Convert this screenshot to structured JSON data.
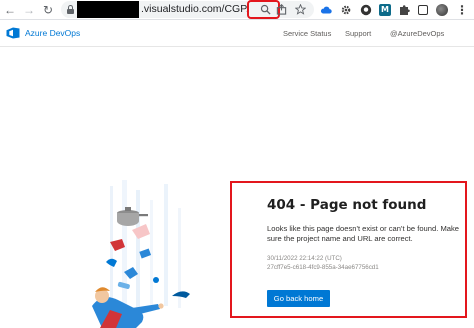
{
  "browser": {
    "back_icon": "←",
    "forward_icon": "→",
    "reload_icon": "↻",
    "url_visible": ".visualstudio.com/CGP.",
    "address_icons": {
      "search": "search-icon",
      "share": "share-icon",
      "bookmark": "star-icon"
    },
    "extensions": [
      "cloud-icon",
      "gear-icon",
      "github-icon",
      "m-extension-icon",
      "puzzle-icon",
      "sidepanel-icon",
      "avatar",
      "menu-dots-icon"
    ],
    "extension_m_label": "M",
    "menu_label": "⋮",
    "accent_color": "#1a73e8"
  },
  "header": {
    "brand": "Azure DevOps",
    "links": {
      "service_status": "Service Status",
      "support": "Support",
      "twitter": "@AzureDevOps"
    },
    "brand_color": "#0078d4"
  },
  "error": {
    "title": "404 - Page not found",
    "description": "Looks like this page doesn't exist or can't be found. Make sure the project name and URL are correct.",
    "timestamp": "30/11/2022 22:14:22 (UTC)",
    "activity_id": "27cff7e5-c618-4fc9-855a-34ae67756cd1",
    "button_label": "Go back home",
    "button_color": "#0078d4"
  },
  "annotations": {
    "highlight_color": "#e3161d"
  }
}
